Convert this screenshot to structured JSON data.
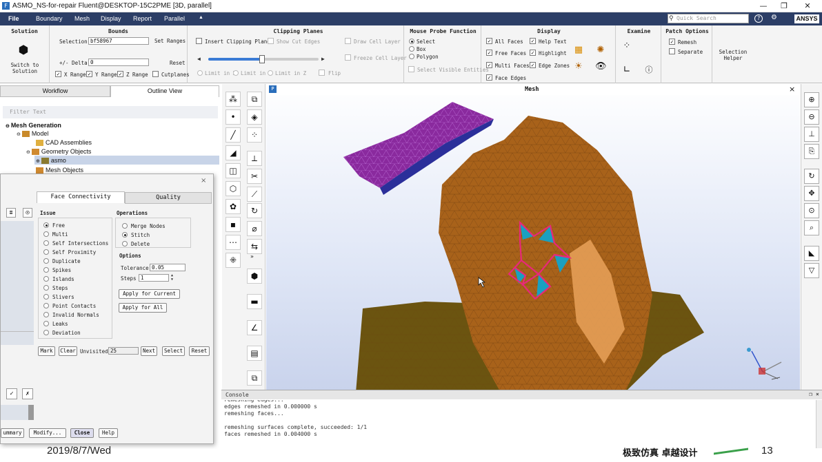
{
  "window": {
    "title": "ASMO_NS-for-repair Fluent@DESKTOP-15C2PME  [3D, parallel]",
    "app_icon": "F"
  },
  "menubar": {
    "items": [
      "File",
      "Boundary",
      "Mesh",
      "Display",
      "Report",
      "Parallel"
    ],
    "overflow": "▲",
    "search_placeholder": "Quick Search",
    "brand": "ANSYS"
  },
  "ribbon": {
    "solution": {
      "header": "Solution",
      "button": "Switch to Solution"
    },
    "bounds": {
      "header": "Bounds",
      "selection_label": "Selection",
      "selection_value": "bf58967",
      "set_ranges": "Set Ranges",
      "delta_label": "+/- Delta",
      "delta_value": "0",
      "reset": "Reset",
      "x_range": "X Range",
      "y_range": "Y Range",
      "z_range": "Z Range",
      "cutplanes": "Cutplanes"
    },
    "clipping": {
      "header": "Clipping Planes",
      "insert": "Insert Clipping Planes",
      "show_cut_edges": "Show Cut Edges",
      "draw_cell_layer": "Draw Cell Layer",
      "freeze_cell_layer": "Freeze Cell Layer",
      "limit_x": "Limit in X",
      "limit_y": "Limit in Y",
      "limit_z": "Limit in Z",
      "flip": "Flip"
    },
    "probe": {
      "header": "Mouse Probe Function",
      "select": "Select",
      "box": "Box",
      "polygon": "Polygon",
      "select_visible": "Select Visible Entities"
    },
    "display": {
      "header": "Display",
      "all_faces": "All Faces",
      "free_faces": "Free Faces",
      "multi_faces": "Multi Faces",
      "face_edges": "Face Edges",
      "help_text": "Help Text",
      "highlight": "Highlight",
      "edge_zones": "Edge Zones"
    },
    "examine": {
      "header": "Examine"
    },
    "patch": {
      "header": "Patch Options",
      "remesh": "Remesh",
      "separate": "Separate"
    },
    "selection_helper": "Selection Helper"
  },
  "leftpanel": {
    "tabs": [
      "Workflow",
      "Outline View"
    ],
    "filter_placeholder": "Filter Text",
    "tree": {
      "root": "Mesh Generation",
      "model": "Model",
      "cad": "CAD Assemblies",
      "geom": "Geometry Objects",
      "asmo": "asmo",
      "mesh_objects": "Mesh Objects"
    }
  },
  "dialog": {
    "tabs": [
      "Face Connectivity",
      "Quality"
    ],
    "issue_header": "Issue",
    "issues": [
      "Free",
      "Multi",
      "Self Intersections",
      "Self Proximity",
      "Duplicate",
      "Spikes",
      "Islands",
      "Steps",
      "Slivers",
      "Point Contacts",
      "Invalid Normals",
      "Leaks",
      "Deviation"
    ],
    "operations_header": "Operations",
    "operations": [
      "Merge Nodes",
      "Stitch",
      "Delete"
    ],
    "options_header": "Options",
    "tolerance_label": "Tolerance",
    "tolerance_value": "0.05",
    "steps_label": "Steps",
    "steps_value": "1",
    "apply_current": "Apply for Current",
    "apply_all": "Apply for All",
    "mark": "Mark",
    "clear": "Clear",
    "unvisited_label": "Unvisited",
    "unvisited_value": "25",
    "next": "Next",
    "select": "Select",
    "reset": "Reset",
    "bottom_buttons": [
      "ummary",
      "Modify...",
      "Close",
      "Help"
    ]
  },
  "viewport": {
    "title": "Mesh"
  },
  "console": {
    "title": "Console",
    "lines": [
      "remeshing edges...",
      "edges remeshed in 0.000000 s",
      "remeshing faces...",
      "",
      "remeshing surfaces complete, succeeded: 1/1",
      "faces remeshed in 0.004000 s"
    ]
  },
  "footer": {
    "date": "2019/8/7/Wed",
    "slogan": "极致仿真 卓越设计",
    "page": "13"
  }
}
